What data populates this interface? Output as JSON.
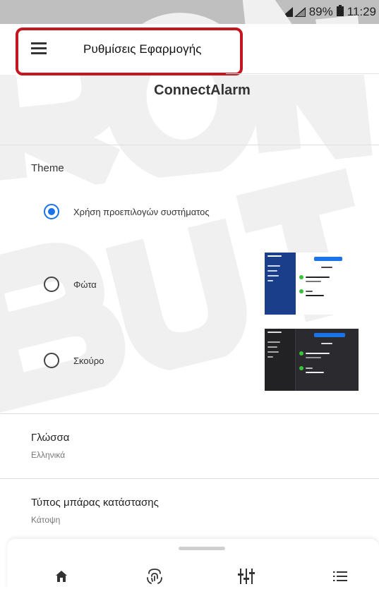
{
  "status_bar": {
    "battery_percent": "89%",
    "time": "11:29"
  },
  "header": {
    "title": "Ρυθμίσεις Εφαρμογής",
    "menu_icon": "hamburger-menu-icon"
  },
  "app_name": "ConnectAlarm",
  "theme": {
    "section_title": "Theme",
    "options": [
      {
        "label": "Χρήση προεπιλογών συστήματος",
        "selected": true
      },
      {
        "label": "Φώτα",
        "selected": false,
        "preview": "light-theme-preview"
      },
      {
        "label": "Σκούρο",
        "selected": false,
        "preview": "dark-theme-preview"
      }
    ]
  },
  "settings": [
    {
      "title": "Γλώσσα",
      "value": "Ελληνικά"
    },
    {
      "title": "Τύπος μπάρας κατάστασης",
      "value": "Κάτοψη"
    }
  ],
  "bottom_nav": [
    {
      "icon": "home-icon"
    },
    {
      "icon": "fingerprint-scan-icon"
    },
    {
      "icon": "equalizer-sliders-icon"
    },
    {
      "icon": "list-icon"
    }
  ],
  "colors": {
    "accent": "#1a73e8",
    "highlight_border": "#c41621",
    "light_preview_sidebar": "#1b3e8a",
    "dark_preview_bg": "#2b2b2f",
    "check_green": "#3ac23a"
  }
}
